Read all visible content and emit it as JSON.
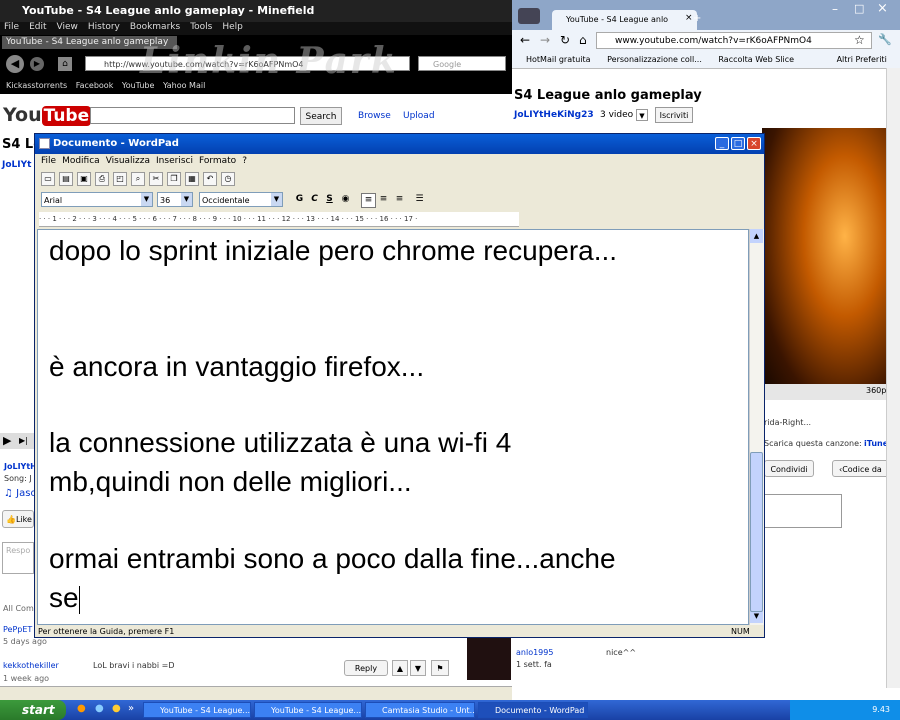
{
  "firefox": {
    "title": "YouTube - S4 League anlo gameplay - Minefield",
    "menu": [
      "File",
      "Edit",
      "View",
      "History",
      "Bookmarks",
      "Tools",
      "Help"
    ],
    "tab": "YouTube - S4 League anlo gameplay",
    "url": "http://www.youtube.com/watch?v=rK6oAFPNmO4",
    "search_placeholder": "Google",
    "bookmarks": [
      "Kickasstorrents",
      "Facebook",
      "YouTube",
      "Yahoo Mail"
    ],
    "banner": "Linkin Park",
    "youtube": {
      "logo_you": "You",
      "logo_tube": "Tube",
      "search_button": "Search",
      "browse": "Browse",
      "upload": "Upload",
      "heading_partial": "S4 Le",
      "channel_partial": "JoLIYt",
      "side_channel": "JoLIYtH",
      "song_partial": "Song: J",
      "jaso": "Jaso",
      "like": "Like",
      "respond": "Respo",
      "all_comments": "All Com",
      "pepe": "PePpET",
      "days_ago": "5 days ago",
      "comment_user": "kekkothekiller",
      "comment_text": "LoL bravi i nabbi =D",
      "comment_time": "1 week ago",
      "reply": "Reply"
    }
  },
  "chrome": {
    "tab": "YouTube - S4 League anlo",
    "url": "www.youtube.com/watch?v=rK6oAFPNmO4",
    "bookmarks": [
      "HotMail gratuita",
      "Personalizzazione coll...",
      "Raccolta Web Slice",
      "Altri Preferiti"
    ],
    "heading": "S4 League anlo gameplay",
    "channel": "JoLIYtHeKiNg23",
    "videos": "3 video",
    "subscribe": "Iscriviti",
    "quality": "360p",
    "song_partial": "rida-Right...",
    "download": "Scarica questa canzone:",
    "itunes": "iTune",
    "share": "Condividi",
    "embed": "‹Codice da",
    "comment_user": "anlo1995",
    "comment_text": "nice^^",
    "comment_time": "1 sett. fa"
  },
  "wordpad": {
    "title": "Documento - WordPad",
    "menu": [
      "File",
      "Modifica",
      "Visualizza",
      "Inserisci",
      "Formato",
      "?"
    ],
    "font": "Arial",
    "size": "36",
    "script": "Occidentale",
    "bold": "G",
    "italic": "C",
    "underline": "S",
    "ruler": "· · · 1 · · · 2 · · · 3 · · · 4 · · · 5 · · · 6 · · · 7 · · · 8 · · · 9 · · · 10 · · · 11 · · · 12 · · · 13 · · · 14 · · · 15 · · · 16 · · · 17 ·",
    "lines": [
      "dopo lo sprint iniziale pero chrome recupera...",
      "è ancora in vantaggio firefox...",
      "la connessione utilizzata è una wi-fi 4",
      "mb,quindi non delle migliori...",
      "ormai entrambi sono a poco dalla fine...anche",
      "se"
    ],
    "status_help": "Per ottenere la Guida, premere F1",
    "status_num": "NUM"
  },
  "taskbar": {
    "start": "start",
    "tasks": [
      "YouTube - S4 League...",
      "YouTube - S4 League...",
      "Camtasia Studio - Unt...",
      "Documento - WordPad"
    ],
    "clock": "9.43"
  }
}
